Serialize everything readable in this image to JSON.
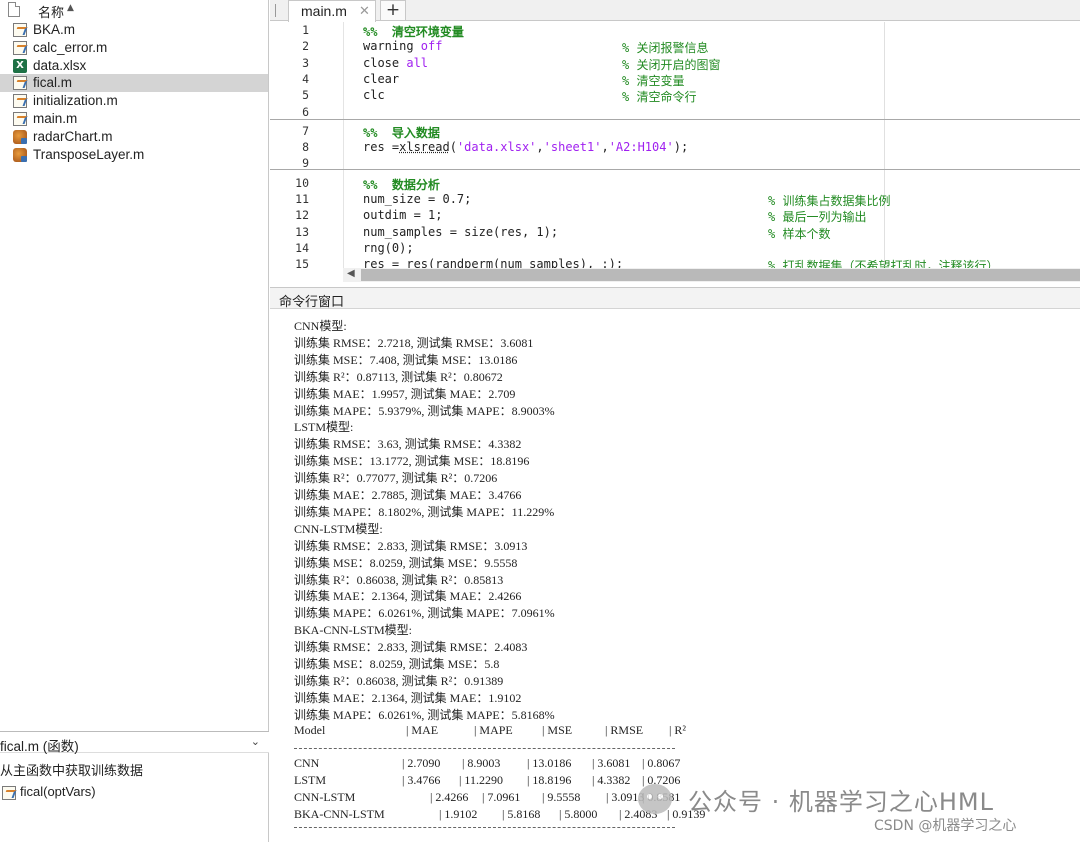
{
  "file_browser": {
    "header_label": "名称",
    "sort_indicator": "▲",
    "files": [
      {
        "name": "BKA.m",
        "icon": "matlab-function-icon",
        "selected": false
      },
      {
        "name": "calc_error.m",
        "icon": "matlab-function-icon",
        "selected": false
      },
      {
        "name": "data.xlsx",
        "icon": "excel-file-icon",
        "selected": false
      },
      {
        "name": "fical.m",
        "icon": "matlab-function-icon",
        "selected": true
      },
      {
        "name": "initialization.m",
        "icon": "matlab-function-icon",
        "selected": false
      },
      {
        "name": "main.m",
        "icon": "matlab-script-icon",
        "selected": false
      },
      {
        "name": "radarChart.m",
        "icon": "matlab-class-icon",
        "selected": false
      },
      {
        "name": "TransposeLayer.m",
        "icon": "matlab-class-icon",
        "selected": false
      }
    ],
    "function_selector": "fical.m (函数)",
    "function_description": "从主函数中获取训练数据",
    "function_signature": "fical(optVars)"
  },
  "editor": {
    "tab_label": "main.m",
    "tab_close": "✕",
    "tab_add": "+",
    "lines": [
      {
        "n": "1",
        "code": [
          {
            "t": "%%  清空环境变量",
            "c": "sec"
          }
        ],
        "comment": ""
      },
      {
        "n": "2",
        "code": [
          {
            "t": "warning ",
            "c": ""
          },
          {
            "t": "off",
            "c": "str"
          }
        ],
        "comment": "% 关闭报警信息"
      },
      {
        "n": "3",
        "code": [
          {
            "t": "close ",
            "c": ""
          },
          {
            "t": "all",
            "c": "str"
          }
        ],
        "comment": "% 关闭开启的图窗"
      },
      {
        "n": "4",
        "code": [
          {
            "t": "clear",
            "c": ""
          }
        ],
        "comment": "% 清空变量"
      },
      {
        "n": "5",
        "code": [
          {
            "t": "clc",
            "c": ""
          }
        ],
        "comment": "% 清空命令行"
      },
      {
        "n": "6",
        "code": [],
        "comment": ""
      },
      {
        "n": "7",
        "code": [
          {
            "t": "%%  导入数据",
            "c": "sec"
          }
        ],
        "comment": ""
      },
      {
        "n": "8",
        "code": [
          {
            "t": "res =",
            "c": ""
          },
          {
            "t": "xlsread",
            "c": "under"
          },
          {
            "t": "(",
            "c": ""
          },
          {
            "t": "'data.xlsx'",
            "c": "str"
          },
          {
            "t": ",",
            "c": ""
          },
          {
            "t": "'sheet1'",
            "c": "str"
          },
          {
            "t": ",",
            "c": ""
          },
          {
            "t": "'A2:H104'",
            "c": "str"
          },
          {
            "t": ");",
            "c": ""
          }
        ],
        "comment": ""
      },
      {
        "n": "9",
        "code": [],
        "comment": ""
      },
      {
        "n": "10",
        "code": [
          {
            "t": "%%  数据分析",
            "c": "sec"
          }
        ],
        "comment": ""
      },
      {
        "n": "11",
        "code": [
          {
            "t": "num_size = 0.7;",
            "c": ""
          }
        ],
        "comment": "% 训练集占数据集比例"
      },
      {
        "n": "12",
        "code": [
          {
            "t": "outdim = 1;",
            "c": ""
          }
        ],
        "comment": "% 最后一列为输出"
      },
      {
        "n": "13",
        "code": [
          {
            "t": "num_samples = size(res, 1);",
            "c": ""
          }
        ],
        "comment": "% 样本个数"
      },
      {
        "n": "14",
        "code": [
          {
            "t": "rng(0);",
            "c": ""
          }
        ],
        "comment": ""
      },
      {
        "n": "15",
        "code": [
          {
            "t": "res = res(randperm(num_samples), :);",
            "c": ""
          }
        ],
        "comment": "% 打乱数据集（不希望打乱时，注释该行）"
      }
    ]
  },
  "command_window": {
    "title": "命令行窗口",
    "output_lines": [
      "CNN模型:",
      "训练集 RMSE：2.7218, 测试集 RMSE：3.6081",
      "训练集 MSE：7.408, 测试集 MSE：13.0186",
      "训练集 R²：0.87113, 测试集 R²：0.80672",
      "训练集 MAE：1.9957, 测试集 MAE：2.709",
      "训练集 MAPE：5.9379%, 测试集 MAPE：8.9003%",
      "LSTM模型:",
      "训练集 RMSE：3.63, 测试集 RMSE：4.3382",
      "训练集 MSE：13.1772, 测试集 MSE：18.8196",
      "训练集 R²：0.77077, 测试集 R²：0.7206",
      "训练集 MAE：2.7885, 测试集 MAE：3.4766",
      "训练集 MAPE：8.1802%, 测试集 MAPE：11.229%",
      "CNN-LSTM模型:",
      "训练集 RMSE：2.833, 测试集 RMSE：3.0913",
      "训练集 MSE：8.0259, 测试集 MSE：9.5558",
      "训练集 R²：0.86038, 测试集 R²：0.85813",
      "训练集 MAE：2.1364, 测试集 MAE：2.4266",
      "训练集 MAPE：6.0261%, 测试集 MAPE：7.0961%",
      "BKA-CNN-LSTM模型:",
      "训练集 RMSE：2.833, 测试集 RMSE：2.4083",
      "训练集 MSE：8.0259, 测试集 MSE：5.8",
      "训练集 R²：0.86038, 测试集 R²：0.91389",
      "训练集 MAE：2.1364, 测试集 MAE：1.9102",
      "训练集 MAPE：6.0261%, 测试集 MAPE：5.8168%"
    ],
    "table_header": [
      "Model",
      "| MAE",
      "| MAPE",
      "| MSE",
      "| RMSE",
      "| R²"
    ],
    "table_rows": [
      [
        "CNN",
        "| 2.7090",
        "| 8.9003",
        "| 13.0186",
        "| 3.6081",
        "| 0.8067"
      ],
      [
        "LSTM",
        "| 3.4766",
        "| 11.2290",
        "| 18.8196",
        "| 4.3382",
        "| 0.7206"
      ],
      [
        "CNN-LSTM",
        "| 2.4266",
        "| 7.0961",
        "| 9.5558",
        "| 3.0913",
        "| 0.8581"
      ],
      [
        "BKA-CNN-LSTM",
        "| 1.9102",
        "| 5.8168",
        "| 5.8000",
        "| 2.4083",
        "| 0.9139"
      ]
    ]
  },
  "watermark": {
    "main": "公众号 · 机器学习之心HML",
    "sub": "CSDN @机器学习之心"
  }
}
